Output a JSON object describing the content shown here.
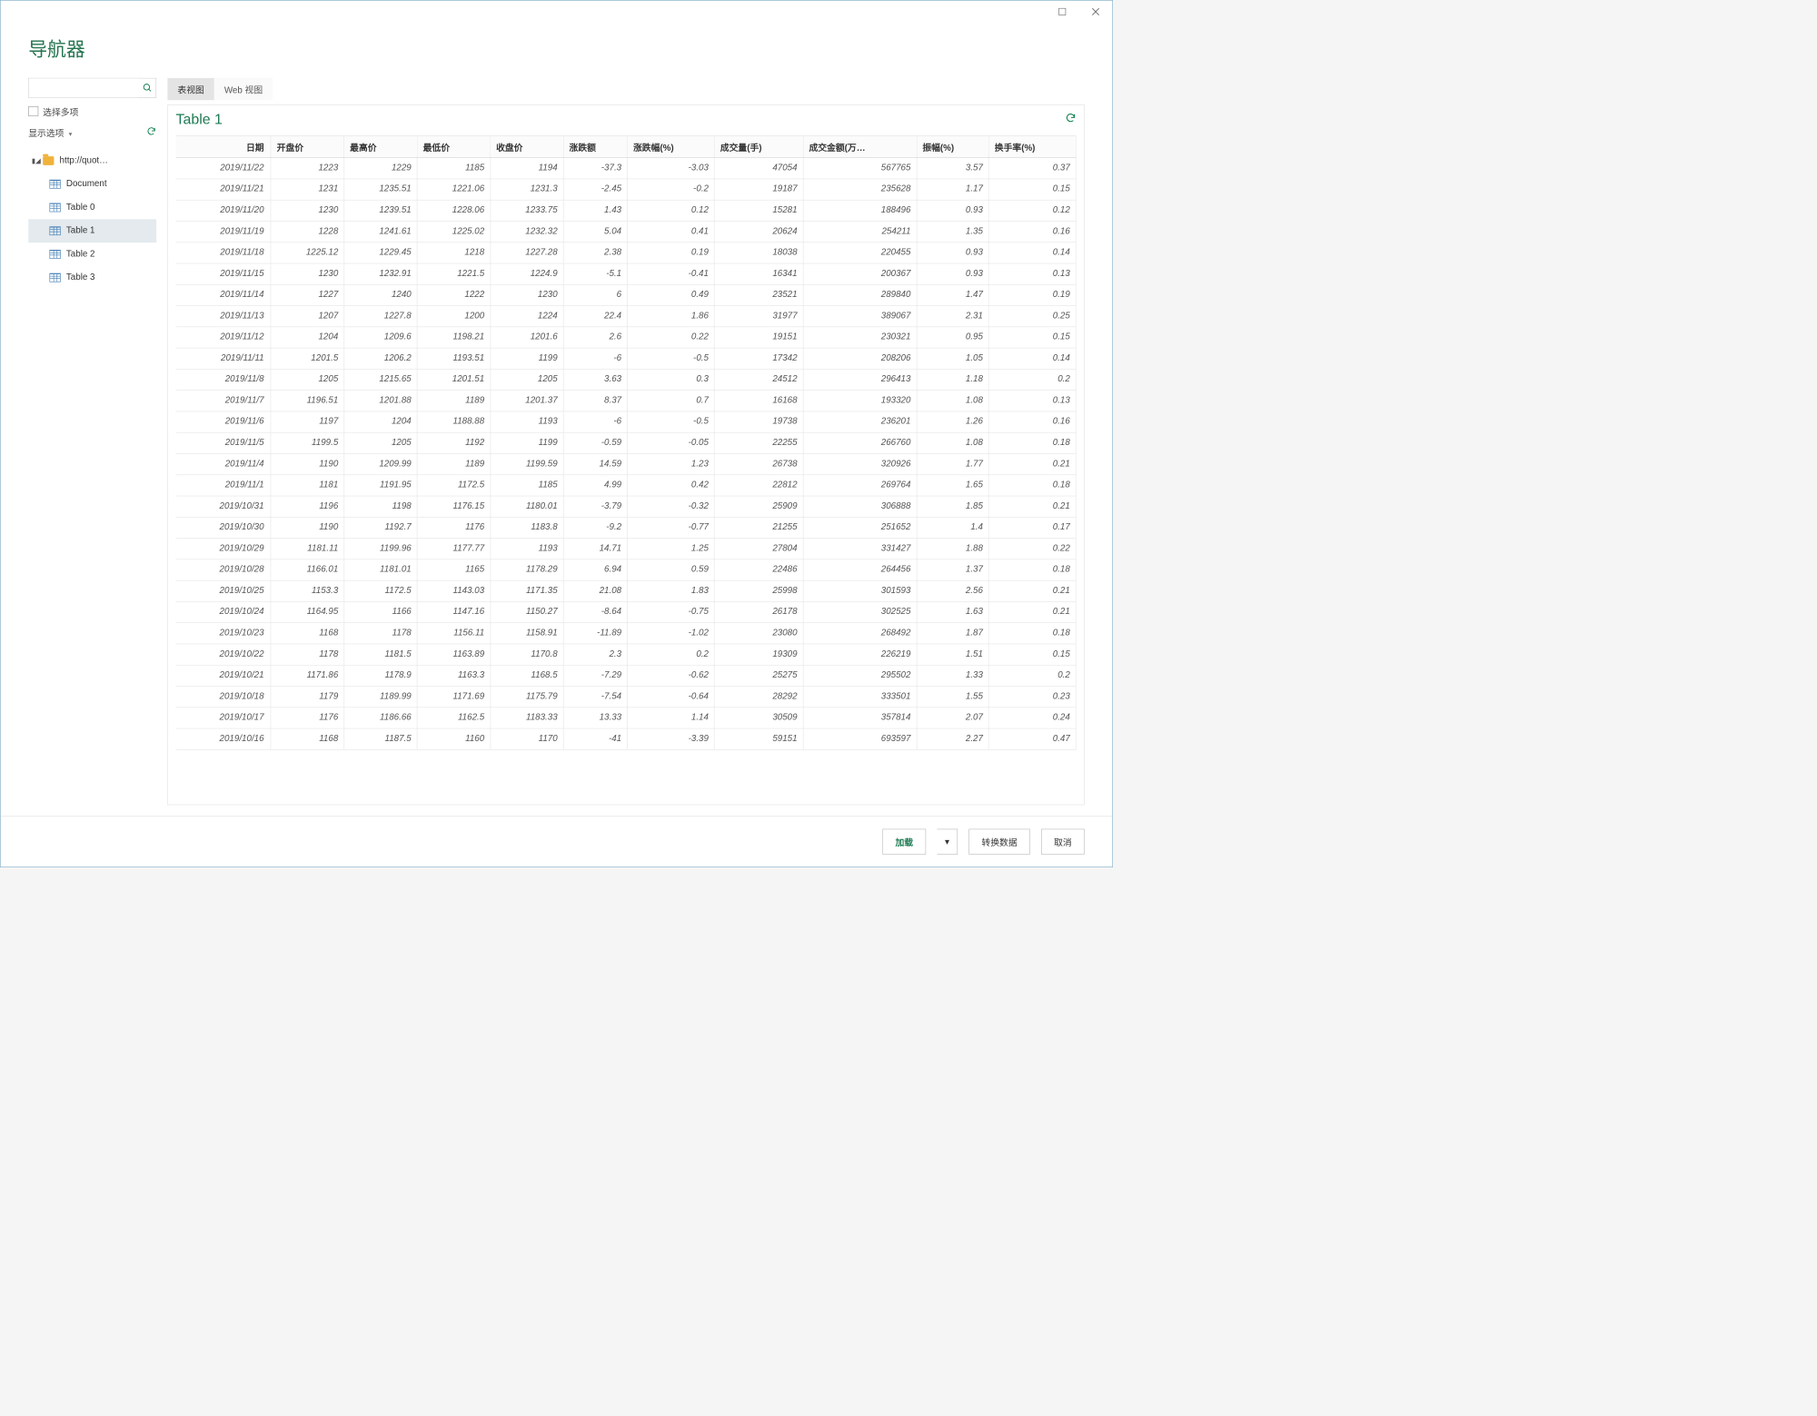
{
  "window": {
    "title": "导航器"
  },
  "left": {
    "search_placeholder": "",
    "multi_select_label": "选择多项",
    "display_options_label": "显示选项",
    "tree": {
      "root_label": "http://quot…",
      "items": [
        {
          "label": "Document"
        },
        {
          "label": "Table 0"
        },
        {
          "label": "Table 1",
          "selected": true
        },
        {
          "label": "Table 2"
        },
        {
          "label": "Table 3"
        }
      ]
    }
  },
  "tabs": {
    "table_view": "表视图",
    "web_view": "Web 视图"
  },
  "preview": {
    "title": "Table 1",
    "columns": [
      "日期",
      "开盘价",
      "最高价",
      "最低价",
      "收盘价",
      "涨跌额",
      "涨跌幅(%)",
      "成交量(手)",
      "成交金额(万…",
      "振幅(%)",
      "换手率(%)"
    ],
    "rows": [
      [
        "2019/11/22",
        "1223",
        "1229",
        "1185",
        "1194",
        "-37.3",
        "-3.03",
        "47054",
        "567765",
        "3.57",
        "0.37"
      ],
      [
        "2019/11/21",
        "1231",
        "1235.51",
        "1221.06",
        "1231.3",
        "-2.45",
        "-0.2",
        "19187",
        "235628",
        "1.17",
        "0.15"
      ],
      [
        "2019/11/20",
        "1230",
        "1239.51",
        "1228.06",
        "1233.75",
        "1.43",
        "0.12",
        "15281",
        "188496",
        "0.93",
        "0.12"
      ],
      [
        "2019/11/19",
        "1228",
        "1241.61",
        "1225.02",
        "1232.32",
        "5.04",
        "0.41",
        "20624",
        "254211",
        "1.35",
        "0.16"
      ],
      [
        "2019/11/18",
        "1225.12",
        "1229.45",
        "1218",
        "1227.28",
        "2.38",
        "0.19",
        "18038",
        "220455",
        "0.93",
        "0.14"
      ],
      [
        "2019/11/15",
        "1230",
        "1232.91",
        "1221.5",
        "1224.9",
        "-5.1",
        "-0.41",
        "16341",
        "200367",
        "0.93",
        "0.13"
      ],
      [
        "2019/11/14",
        "1227",
        "1240",
        "1222",
        "1230",
        "6",
        "0.49",
        "23521",
        "289840",
        "1.47",
        "0.19"
      ],
      [
        "2019/11/13",
        "1207",
        "1227.8",
        "1200",
        "1224",
        "22.4",
        "1.86",
        "31977",
        "389067",
        "2.31",
        "0.25"
      ],
      [
        "2019/11/12",
        "1204",
        "1209.6",
        "1198.21",
        "1201.6",
        "2.6",
        "0.22",
        "19151",
        "230321",
        "0.95",
        "0.15"
      ],
      [
        "2019/11/11",
        "1201.5",
        "1206.2",
        "1193.51",
        "1199",
        "-6",
        "-0.5",
        "17342",
        "208206",
        "1.05",
        "0.14"
      ],
      [
        "2019/11/8",
        "1205",
        "1215.65",
        "1201.51",
        "1205",
        "3.63",
        "0.3",
        "24512",
        "296413",
        "1.18",
        "0.2"
      ],
      [
        "2019/11/7",
        "1196.51",
        "1201.88",
        "1189",
        "1201.37",
        "8.37",
        "0.7",
        "16168",
        "193320",
        "1.08",
        "0.13"
      ],
      [
        "2019/11/6",
        "1197",
        "1204",
        "1188.88",
        "1193",
        "-6",
        "-0.5",
        "19738",
        "236201",
        "1.26",
        "0.16"
      ],
      [
        "2019/11/5",
        "1199.5",
        "1205",
        "1192",
        "1199",
        "-0.59",
        "-0.05",
        "22255",
        "266760",
        "1.08",
        "0.18"
      ],
      [
        "2019/11/4",
        "1190",
        "1209.99",
        "1189",
        "1199.59",
        "14.59",
        "1.23",
        "26738",
        "320926",
        "1.77",
        "0.21"
      ],
      [
        "2019/11/1",
        "1181",
        "1191.95",
        "1172.5",
        "1185",
        "4.99",
        "0.42",
        "22812",
        "269764",
        "1.65",
        "0.18"
      ],
      [
        "2019/10/31",
        "1196",
        "1198",
        "1176.15",
        "1180.01",
        "-3.79",
        "-0.32",
        "25909",
        "306888",
        "1.85",
        "0.21"
      ],
      [
        "2019/10/30",
        "1190",
        "1192.7",
        "1176",
        "1183.8",
        "-9.2",
        "-0.77",
        "21255",
        "251652",
        "1.4",
        "0.17"
      ],
      [
        "2019/10/29",
        "1181.11",
        "1199.96",
        "1177.77",
        "1193",
        "14.71",
        "1.25",
        "27804",
        "331427",
        "1.88",
        "0.22"
      ],
      [
        "2019/10/28",
        "1166.01",
        "1181.01",
        "1165",
        "1178.29",
        "6.94",
        "0.59",
        "22486",
        "264456",
        "1.37",
        "0.18"
      ],
      [
        "2019/10/25",
        "1153.3",
        "1172.5",
        "1143.03",
        "1171.35",
        "21.08",
        "1.83",
        "25998",
        "301593",
        "2.56",
        "0.21"
      ],
      [
        "2019/10/24",
        "1164.95",
        "1166",
        "1147.16",
        "1150.27",
        "-8.64",
        "-0.75",
        "26178",
        "302525",
        "1.63",
        "0.21"
      ],
      [
        "2019/10/23",
        "1168",
        "1178",
        "1156.11",
        "1158.91",
        "-11.89",
        "-1.02",
        "23080",
        "268492",
        "1.87",
        "0.18"
      ],
      [
        "2019/10/22",
        "1178",
        "1181.5",
        "1163.89",
        "1170.8",
        "2.3",
        "0.2",
        "19309",
        "226219",
        "1.51",
        "0.15"
      ],
      [
        "2019/10/21",
        "1171.86",
        "1178.9",
        "1163.3",
        "1168.5",
        "-7.29",
        "-0.62",
        "25275",
        "295502",
        "1.33",
        "0.2"
      ],
      [
        "2019/10/18",
        "1179",
        "1189.99",
        "1171.69",
        "1175.79",
        "-7.54",
        "-0.64",
        "28292",
        "333501",
        "1.55",
        "0.23"
      ],
      [
        "2019/10/17",
        "1176",
        "1186.66",
        "1162.5",
        "1183.33",
        "13.33",
        "1.14",
        "30509",
        "357814",
        "2.07",
        "0.24"
      ],
      [
        "2019/10/16",
        "1168",
        "1187.5",
        "1160",
        "1170",
        "-41",
        "-3.39",
        "59151",
        "693597",
        "2.27",
        "0.47"
      ]
    ]
  },
  "footer": {
    "load": "加载",
    "transform": "转换数据",
    "cancel": "取消"
  }
}
